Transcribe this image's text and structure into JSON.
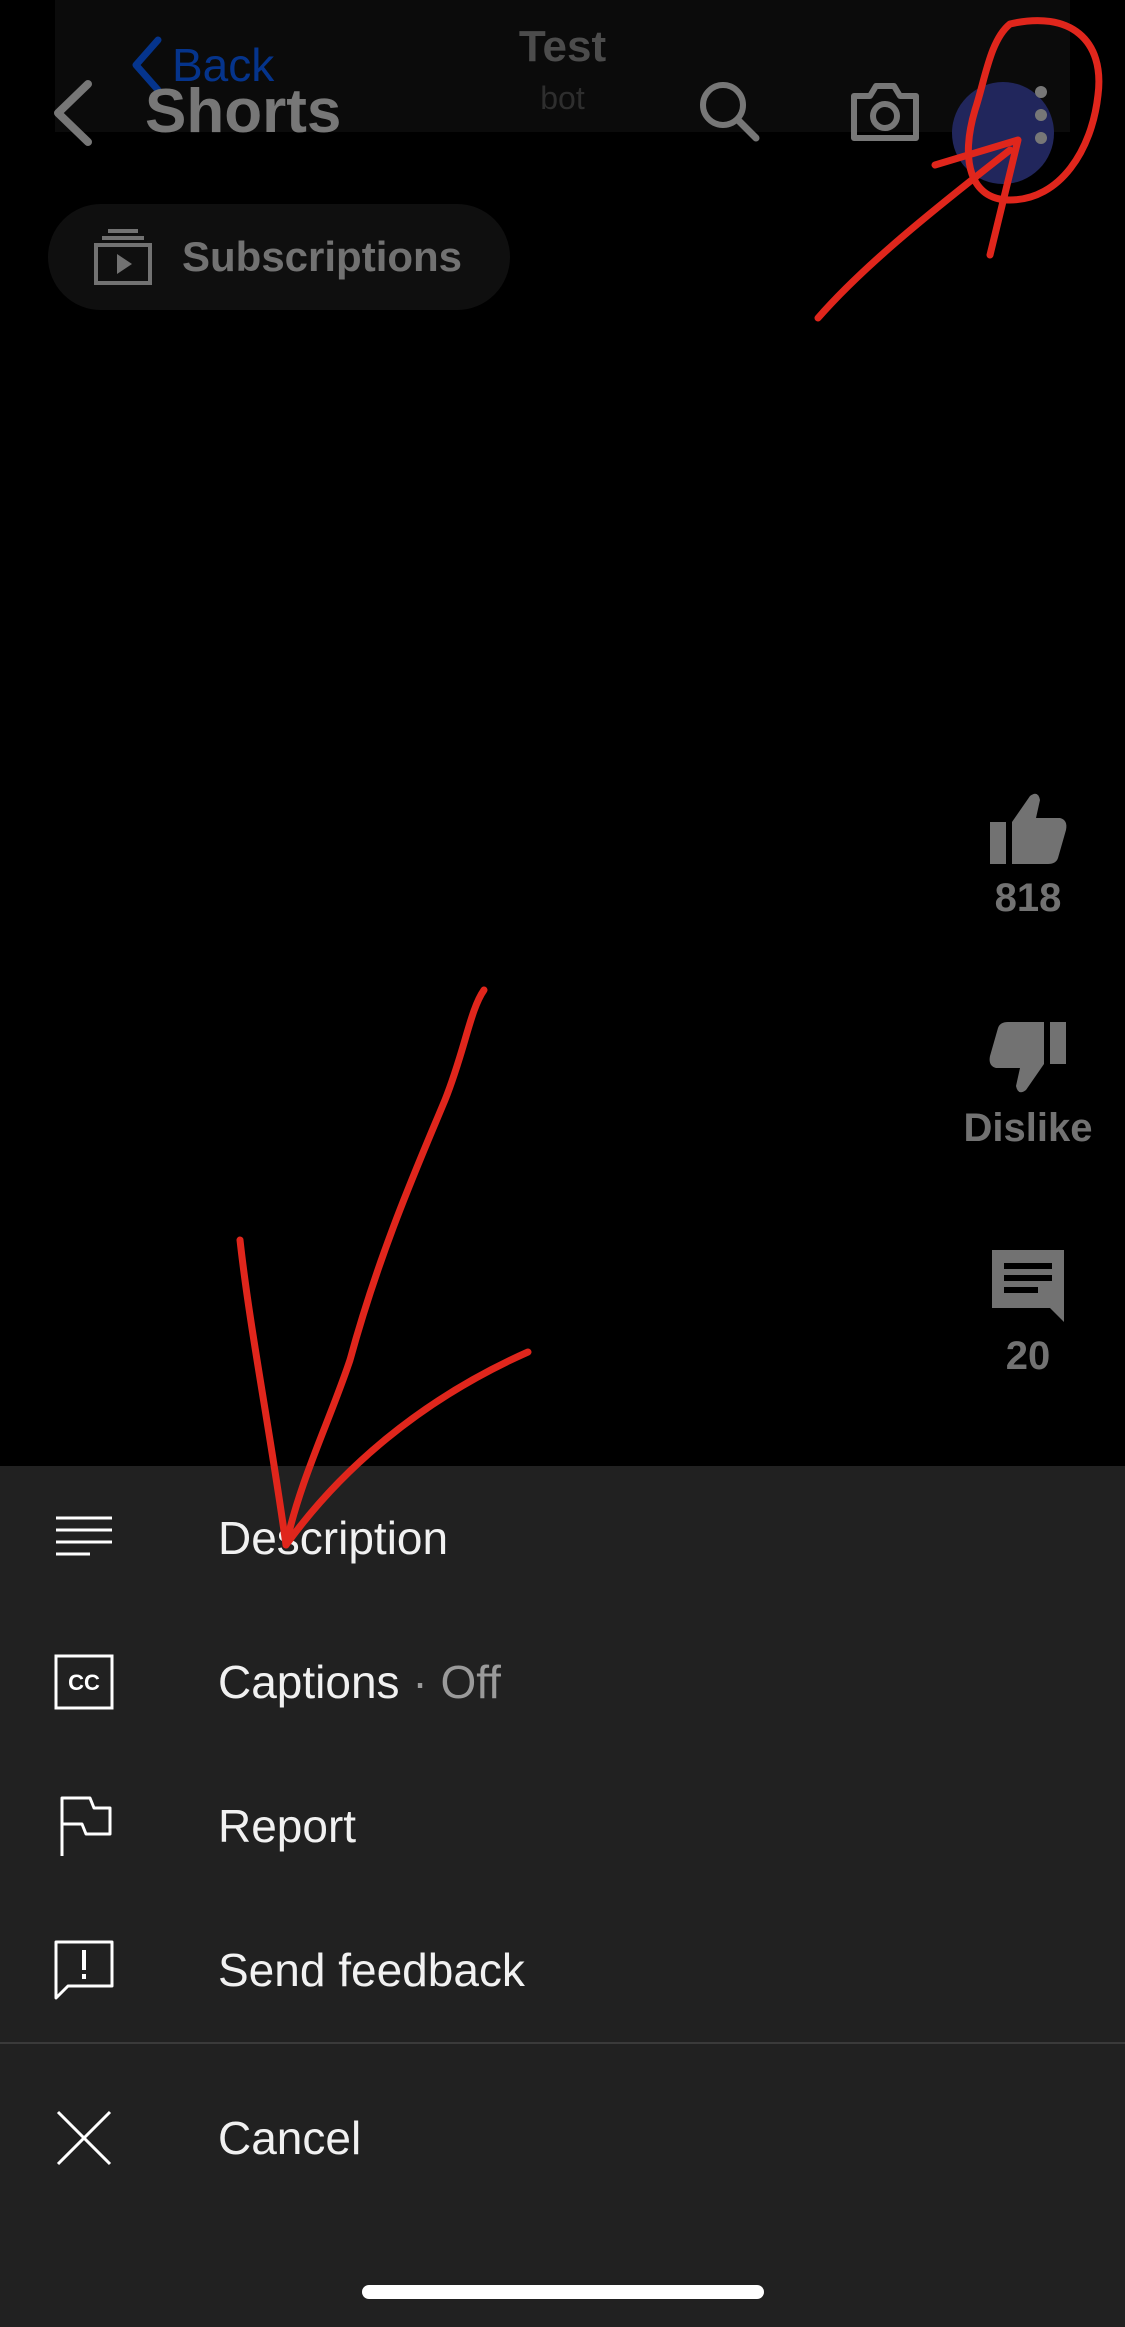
{
  "banner": {
    "back_label": "Back",
    "title": "Test",
    "subtitle": "bot"
  },
  "header": {
    "title": "Shorts"
  },
  "chips": {
    "subscriptions": "Subscriptions"
  },
  "rail": {
    "like_count": "818",
    "dislike_label": "Dislike",
    "comment_count": "20"
  },
  "menu": {
    "description": "Description",
    "captions": "Captions",
    "captions_state": "· Off",
    "report": "Report",
    "send_feedback": "Send feedback",
    "cancel": "Cancel"
  },
  "colors": {
    "sheet_bg": "#212121",
    "annotation": "#e0261c",
    "ios_link": "#0a60ff"
  },
  "icons": [
    "chevron-left-icon",
    "search-icon",
    "camera-icon",
    "more-vert-icon",
    "subscriptions-icon",
    "thumb-up-icon",
    "thumb-down-icon",
    "comment-icon",
    "description-icon",
    "captions-icon",
    "flag-icon",
    "feedback-icon",
    "close-icon"
  ]
}
